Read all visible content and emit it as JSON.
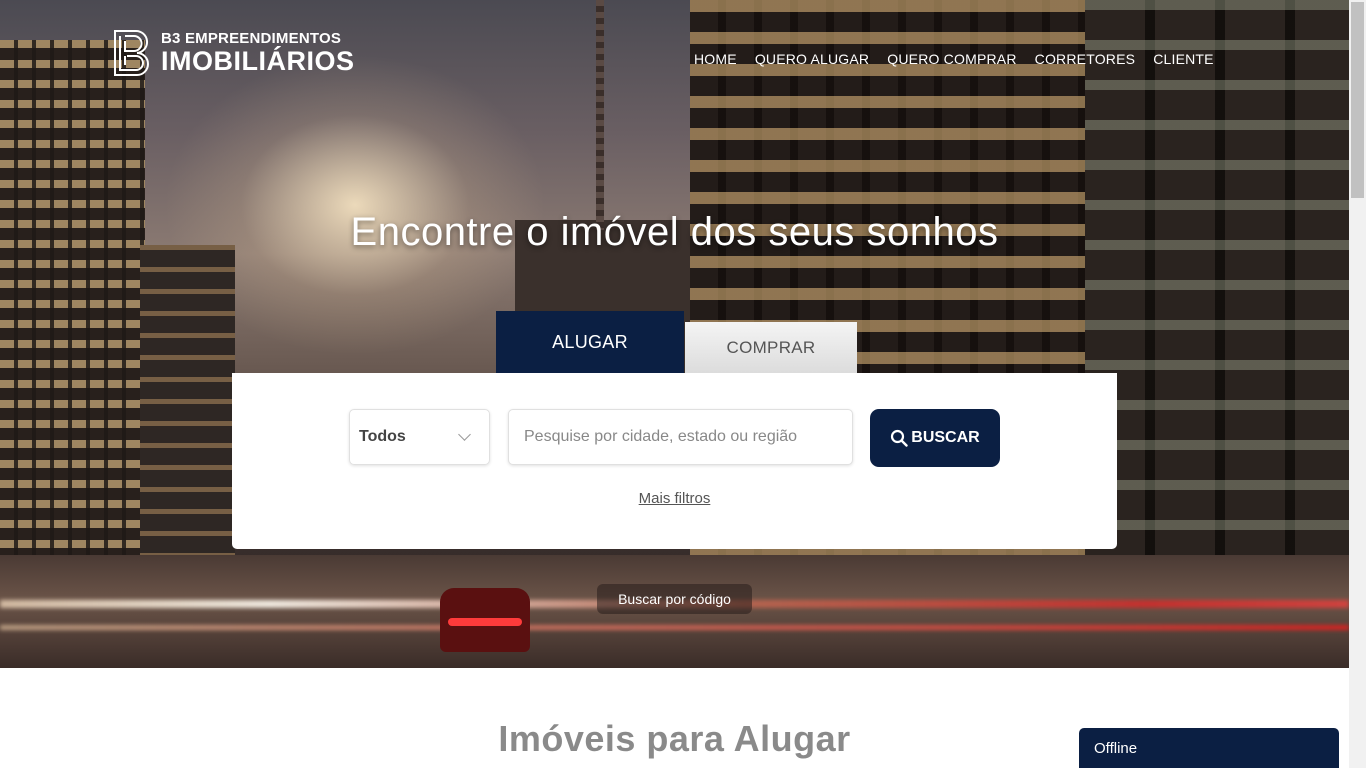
{
  "brand": {
    "line1": "B3 EMPREENDIMENTOS",
    "line2": "IMOBILIÁRIOS"
  },
  "nav": {
    "items": [
      {
        "label": "HOME"
      },
      {
        "label": "QUERO ALUGAR"
      },
      {
        "label": "QUERO COMPRAR"
      },
      {
        "label": "CORRETORES"
      },
      {
        "label": "CLIENTE"
      }
    ]
  },
  "hero": {
    "headline": "Encontre o imóvel dos seus sonhos"
  },
  "search": {
    "tabs": [
      {
        "label": "ALUGAR",
        "active": true
      },
      {
        "label": "COMPRAR",
        "active": false
      }
    ],
    "type_select": {
      "value": "Todos"
    },
    "input_placeholder": "Pesquise por cidade, estado ou região",
    "input_value": "",
    "button_label": "BUSCAR",
    "button_icon": "search-icon",
    "more_filters": "Mais filtros",
    "by_code": "Buscar por código"
  },
  "section": {
    "title": "Imóveis para Alugar"
  },
  "chat": {
    "status": "Offline"
  },
  "colors": {
    "primary": "#0b1f43",
    "white": "#ffffff",
    "muted_title": "#8a8a8a"
  }
}
